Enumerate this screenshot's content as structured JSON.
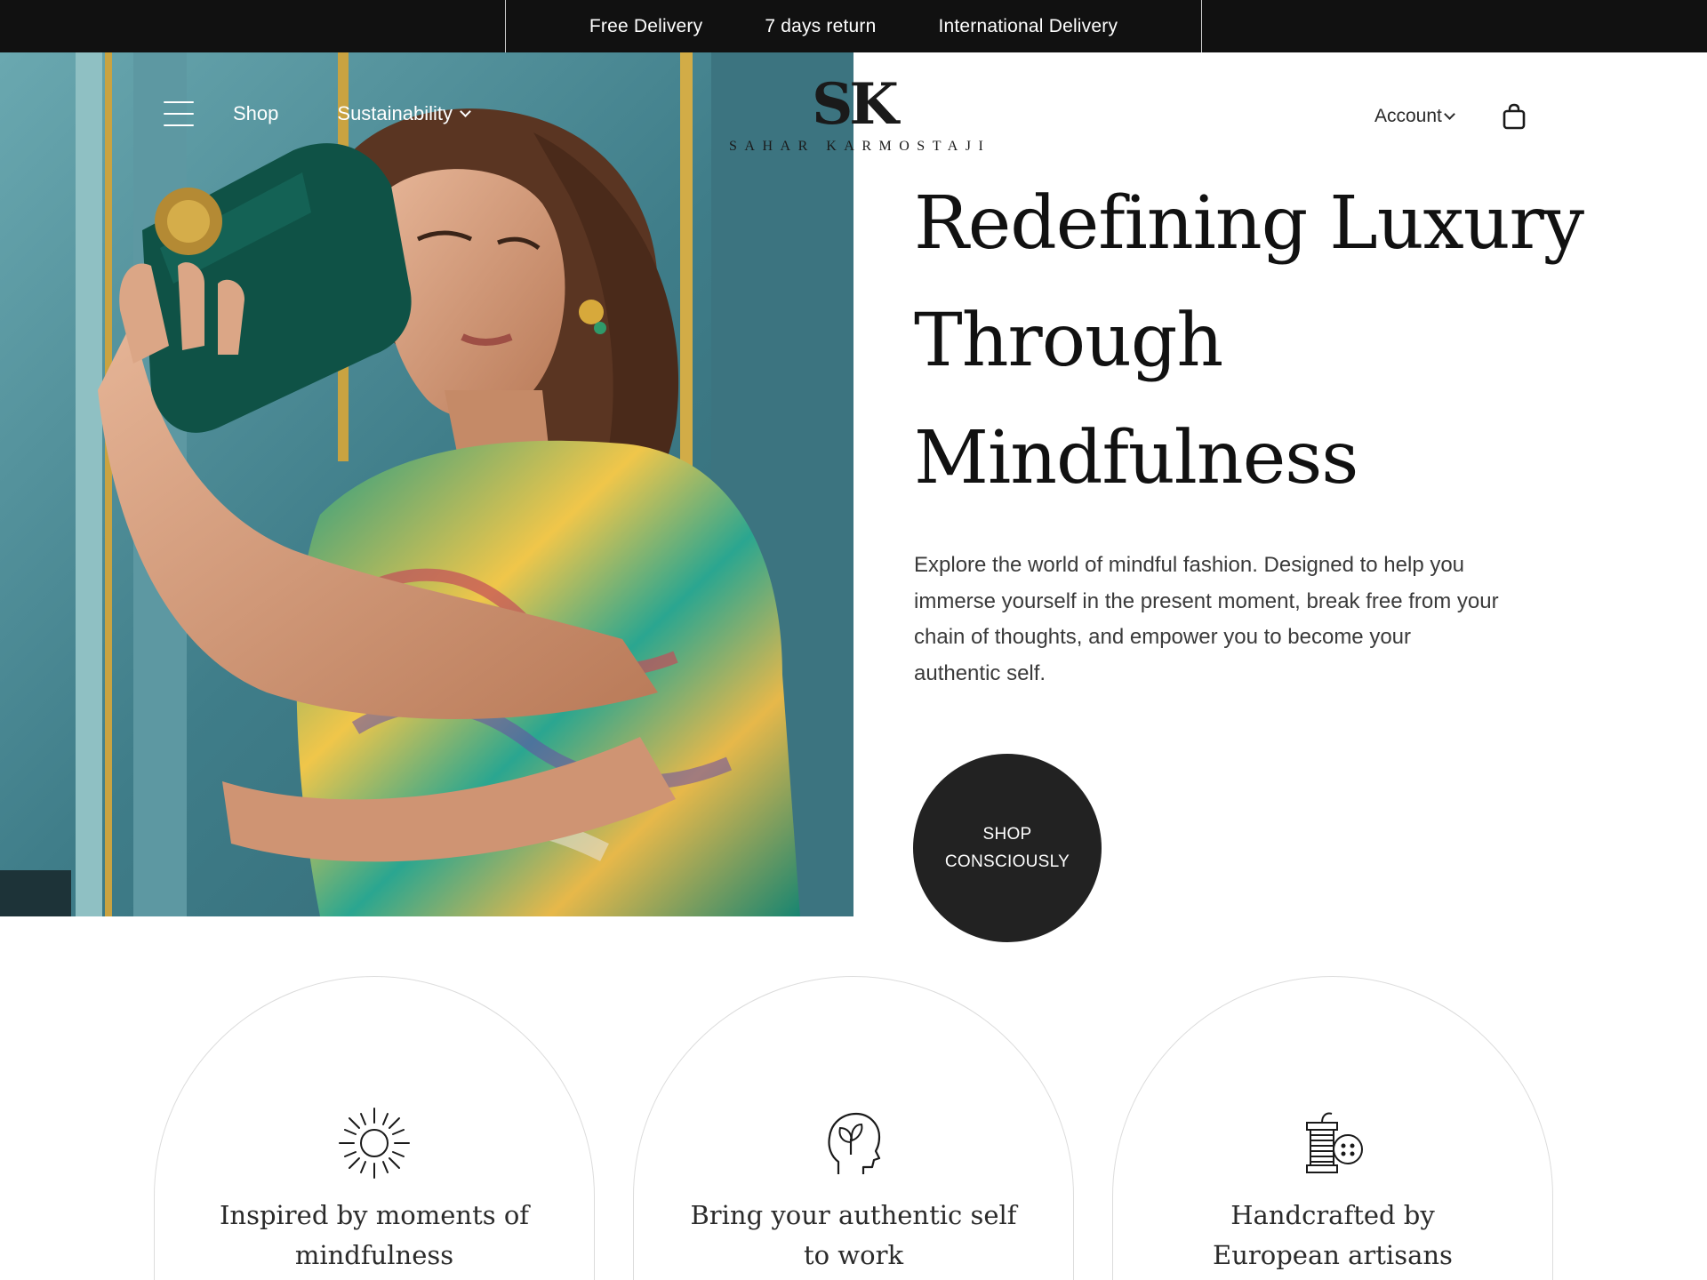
{
  "topbar": {
    "items": [
      "Free Delivery",
      "7 days return",
      "International Delivery"
    ]
  },
  "nav": {
    "shop": "Shop",
    "sustainability": "Sustainability",
    "account": "Account"
  },
  "logo": {
    "mark": "SK",
    "name": "SAHAR KARMOSTAJI"
  },
  "hero": {
    "headline_lines": [
      "Redefining Luxury",
      "Through",
      "Mindfulness"
    ],
    "lead": "Explore the world of mindful fashion. Designed to help you immerse yourself in the present moment, break free from your chain of thoughts, and empower you to become your authentic self.",
    "cta_line1": "SHOP",
    "cta_line2": "CONSCIOUSLY"
  },
  "features": [
    {
      "icon": "sun-icon",
      "label": "Inspired by moments of mindfulness"
    },
    {
      "icon": "head-leaf-icon",
      "label": "Bring your authentic self to work"
    },
    {
      "icon": "thread-spool-icon",
      "label": "Handcrafted by European artisans"
    }
  ],
  "colors": {
    "topbar_bg": "#111111",
    "cta_bg": "#222222",
    "text": "#111111"
  }
}
